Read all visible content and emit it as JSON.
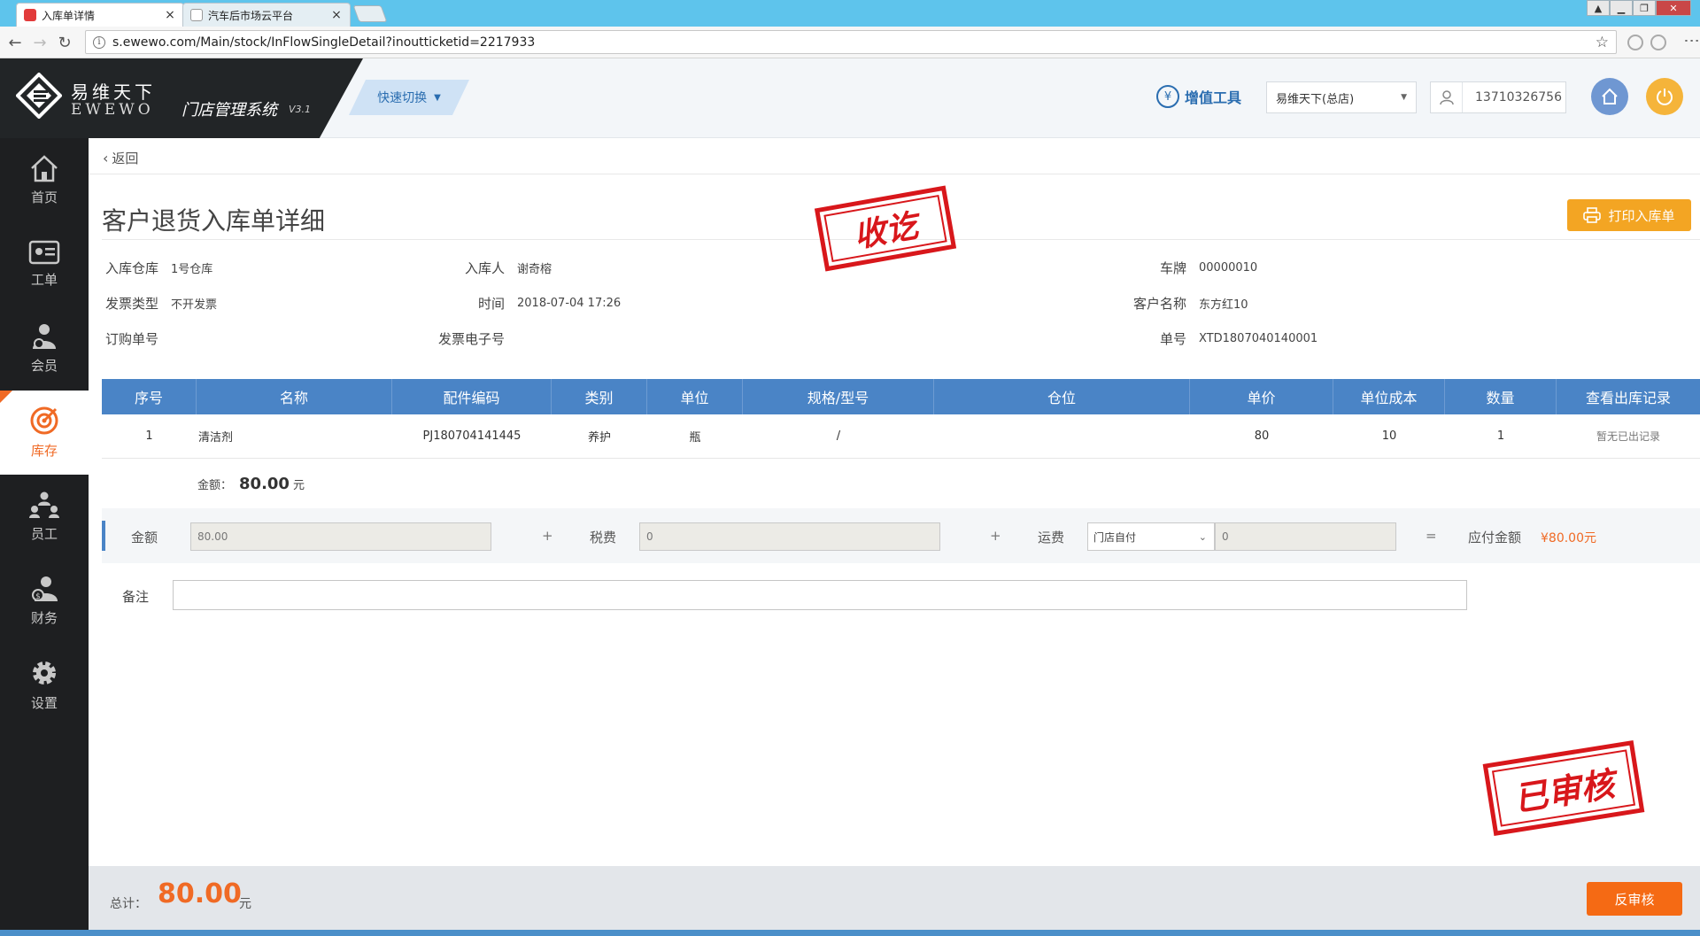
{
  "browser": {
    "tabs": [
      {
        "title": "入库单详情",
        "close": "×"
      },
      {
        "title": "汽车后市场云平台",
        "close": "×"
      }
    ],
    "url": "s.ewewo.com/Main/stock/InFlowSingleDetail?inoutticketid=2217933"
  },
  "header": {
    "brand_cn": "易维天下",
    "brand_en": "EWEWO",
    "system_name": "门店管理系统",
    "version": "V3.1",
    "quick_switch": "快速切换",
    "tools_label": "增值工具",
    "store": "易维天下(总店)",
    "user_phone": "13710326756"
  },
  "sidebar": {
    "items": [
      {
        "label": "首页",
        "icon": "home-icon"
      },
      {
        "label": "工单",
        "icon": "work-order-icon"
      },
      {
        "label": "会员",
        "icon": "member-icon"
      },
      {
        "label": "库存",
        "icon": "inventory-icon",
        "active": true
      },
      {
        "label": "员工",
        "icon": "staff-icon"
      },
      {
        "label": "财务",
        "icon": "finance-icon"
      },
      {
        "label": "设置",
        "icon": "settings-icon"
      }
    ]
  },
  "page": {
    "back": "返回",
    "title": "客户退货入库单详细",
    "print_button": "打印入库单",
    "stamp_received": "收讫",
    "stamp_audited": "已审核"
  },
  "info": {
    "warehouse_label": "入库仓库",
    "warehouse": "1号仓库",
    "operator_label": "入库人",
    "operator": "谢奇榕",
    "plate_label": "车牌",
    "plate": "00000010",
    "invoice_type_label": "发票类型",
    "invoice_type": "不开发票",
    "time_label": "时间",
    "time": "2018-07-04 17:26",
    "customer_label": "客户名称",
    "customer": "东方红10",
    "purchase_no_label": "订购单号",
    "purchase_no": "",
    "einvoice_label": "发票电子号",
    "einvoice": "",
    "ticket_no_label": "单号",
    "ticket_no": "XTD1807040140001"
  },
  "table": {
    "columns": [
      "序号",
      "名称",
      "配件编码",
      "类别",
      "单位",
      "规格/型号",
      "仓位",
      "单价",
      "单位成本",
      "数量",
      "查看出库记录"
    ],
    "rows": [
      {
        "no": "1",
        "name": "清洁剂",
        "code": "PJ180704141445",
        "category": "养护",
        "unit": "瓶",
        "spec": "/",
        "location": "",
        "price": "80",
        "cost": "10",
        "qty": "1",
        "record": "暂无已出记录"
      }
    ],
    "amount_label": "金额：",
    "amount_value": "80.00",
    "amount_unit": "元"
  },
  "fees": {
    "amount_label": "金额",
    "amount_value": "80.00",
    "plus": "+",
    "tax_label": "税费",
    "tax_value": "0",
    "freight_label": "运费",
    "freight_option": "门店自付",
    "freight_value": "0",
    "equals": "=",
    "payable_label": "应付金额",
    "payable_value": "¥80.00元"
  },
  "remark": {
    "label": "备注",
    "value": ""
  },
  "footer": {
    "total_label": "总计：",
    "total_value": "80.00",
    "total_unit": "元",
    "reaudit_button": "反审核"
  },
  "colors": {
    "accent_blue": "#4a84c6",
    "accent_orange": "#f06a25",
    "stamp_red": "#d8171b",
    "sidebar_bg": "#1e1f21"
  }
}
